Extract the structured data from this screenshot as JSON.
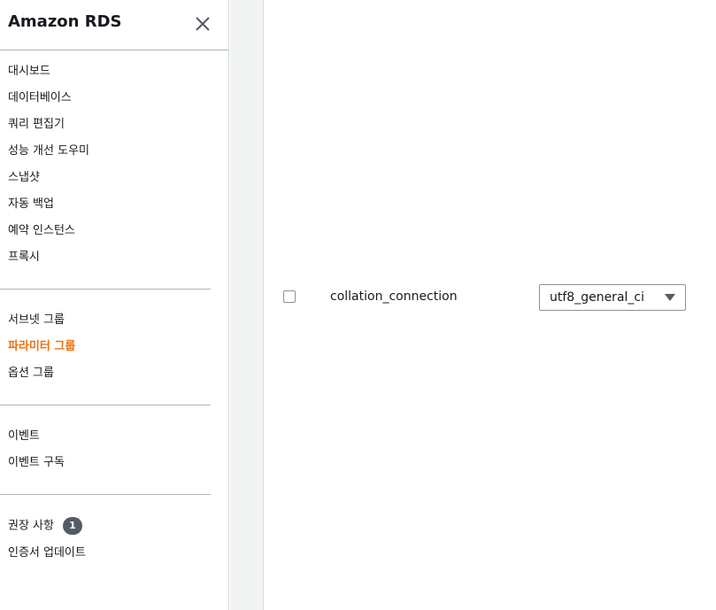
{
  "sidebar": {
    "title": "Amazon RDS",
    "groups": [
      {
        "items": [
          {
            "label": "대시보드"
          },
          {
            "label": "데이터베이스"
          },
          {
            "label": "쿼리 편집기"
          },
          {
            "label": "성능 개선 도우미"
          },
          {
            "label": "스냅샷"
          },
          {
            "label": "자동 백업"
          },
          {
            "label": "예약 인스턴스"
          },
          {
            "label": "프록시"
          }
        ]
      },
      {
        "items": [
          {
            "label": "서브넷 그룹"
          },
          {
            "label": "파라미터 그룹",
            "active": true
          },
          {
            "label": "옵션 그룹"
          }
        ]
      },
      {
        "items": [
          {
            "label": "이벤트"
          },
          {
            "label": "이벤트 구독"
          }
        ]
      },
      {
        "items": [
          {
            "label": "권장 사항",
            "badge": "1"
          },
          {
            "label": "인증서 업데이트"
          }
        ]
      }
    ]
  },
  "main": {
    "parameter": {
      "name": "collation_connection",
      "value": "utf8_general_ci",
      "checked": false
    }
  },
  "colors": {
    "accent_active": "#ec7211",
    "badge_bg": "#545b64",
    "divider": "#aab7b8"
  },
  "icons": {
    "close": "close-icon",
    "dropdown": "caret-down-icon"
  }
}
